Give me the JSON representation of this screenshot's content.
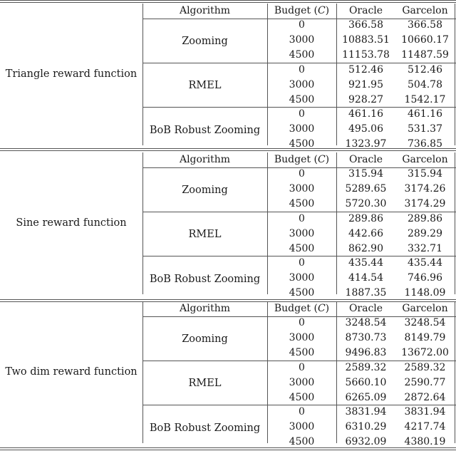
{
  "headers": {
    "algorithm": "Algorithm",
    "budget": "Budget (",
    "budget_var": "C",
    "budget_close": ")",
    "oracle": "Oracle",
    "garcelon": "Garcelon"
  },
  "blocks": [
    {
      "function": "Triangle reward function",
      "algorithms": [
        {
          "name": "Zooming",
          "rows": [
            {
              "budget": "0",
              "oracle": "366.58",
              "garcelon": "366.58"
            },
            {
              "budget": "3000",
              "oracle": "10883.51",
              "garcelon": "10660.17"
            },
            {
              "budget": "4500",
              "oracle": "11153.78",
              "garcelon": "11487.59"
            }
          ]
        },
        {
          "name": "RMEL",
          "rows": [
            {
              "budget": "0",
              "oracle": "512.46",
              "garcelon": "512.46"
            },
            {
              "budget": "3000",
              "oracle": "921.95",
              "garcelon": "504.78"
            },
            {
              "budget": "4500",
              "oracle": "928.27",
              "garcelon": "1542.17"
            }
          ]
        },
        {
          "name": "BoB Robust Zooming",
          "rows": [
            {
              "budget": "0",
              "oracle": "461.16",
              "garcelon": "461.16"
            },
            {
              "budget": "3000",
              "oracle": "495.06",
              "garcelon": "531.37"
            },
            {
              "budget": "4500",
              "oracle": "1323.97",
              "garcelon": "736.85"
            }
          ]
        }
      ]
    },
    {
      "function": "Sine reward function",
      "algorithms": [
        {
          "name": "Zooming",
          "rows": [
            {
              "budget": "0",
              "oracle": "315.94",
              "garcelon": "315.94"
            },
            {
              "budget": "3000",
              "oracle": "5289.65",
              "garcelon": "3174.26"
            },
            {
              "budget": "4500",
              "oracle": "5720.30",
              "garcelon": "3174.29"
            }
          ]
        },
        {
          "name": "RMEL",
          "rows": [
            {
              "budget": "0",
              "oracle": "289.86",
              "garcelon": "289.86"
            },
            {
              "budget": "3000",
              "oracle": "442.66",
              "garcelon": "289.29"
            },
            {
              "budget": "4500",
              "oracle": "862.90",
              "garcelon": "332.71"
            }
          ]
        },
        {
          "name": "BoB Robust Zooming",
          "rows": [
            {
              "budget": "0",
              "oracle": "435.44",
              "garcelon": "435.44"
            },
            {
              "budget": "3000",
              "oracle": "414.54",
              "garcelon": "746.96"
            },
            {
              "budget": "4500",
              "oracle": "1887.35",
              "garcelon": "1148.09"
            }
          ]
        }
      ]
    },
    {
      "function": "Two dim reward function",
      "algorithms": [
        {
          "name": "Zooming",
          "rows": [
            {
              "budget": "0",
              "oracle": "3248.54",
              "garcelon": "3248.54"
            },
            {
              "budget": "3000",
              "oracle": "8730.73",
              "garcelon": "8149.79"
            },
            {
              "budget": "4500",
              "oracle": "9496.83",
              "garcelon": "13672.00"
            }
          ]
        },
        {
          "name": "RMEL",
          "rows": [
            {
              "budget": "0",
              "oracle": "2589.32",
              "garcelon": "2589.32"
            },
            {
              "budget": "3000",
              "oracle": "5660.10",
              "garcelon": "2590.77"
            },
            {
              "budget": "4500",
              "oracle": "6265.09",
              "garcelon": "2872.64"
            }
          ]
        },
        {
          "name": "BoB Robust Zooming",
          "rows": [
            {
              "budget": "0",
              "oracle": "3831.94",
              "garcelon": "3831.94"
            },
            {
              "budget": "3000",
              "oracle": "6310.29",
              "garcelon": "4217.74"
            },
            {
              "budget": "4500",
              "oracle": "6932.09",
              "garcelon": "4380.19"
            }
          ]
        }
      ]
    }
  ]
}
